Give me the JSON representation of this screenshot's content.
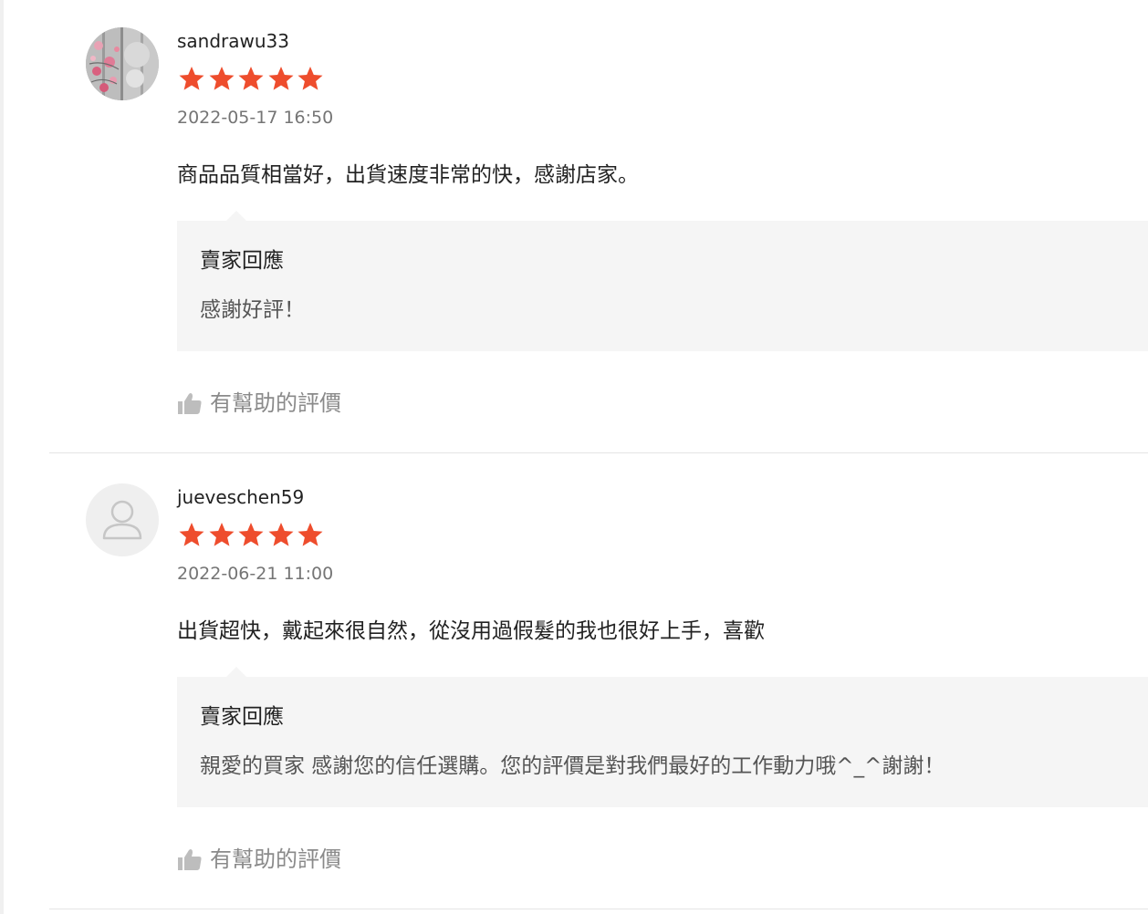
{
  "colors": {
    "star": "#ee4d2d",
    "reply_background": "#f5f5f5",
    "muted_text": "#757575",
    "divider": "#e5e5e5"
  },
  "reviews": [
    {
      "username": "sandrawu33",
      "avatar": "profile-photo",
      "rating": 5,
      "timestamp": "2022-05-17 16:50",
      "comment": "商品品質相當好，出貨速度非常的快，感謝店家。",
      "seller_reply": {
        "title": "賣家回應",
        "text": "感謝好評！"
      },
      "helpful_label": "有幫助的評價",
      "helpful_icon": "thumbs-up-icon"
    },
    {
      "username": "jueveschen59",
      "avatar": "default-user-icon",
      "rating": 5,
      "timestamp": "2022-06-21 11:00",
      "comment": "出貨超快，戴起來很自然，從沒用過假髮的我也很好上手，喜歡",
      "seller_reply": {
        "title": "賣家回應",
        "text": "親愛的買家 感謝您的信任選購。您的評價是對我們最好的工作動力哦^_^謝謝！"
      },
      "helpful_label": "有幫助的評價",
      "helpful_icon": "thumbs-up-icon"
    }
  ]
}
